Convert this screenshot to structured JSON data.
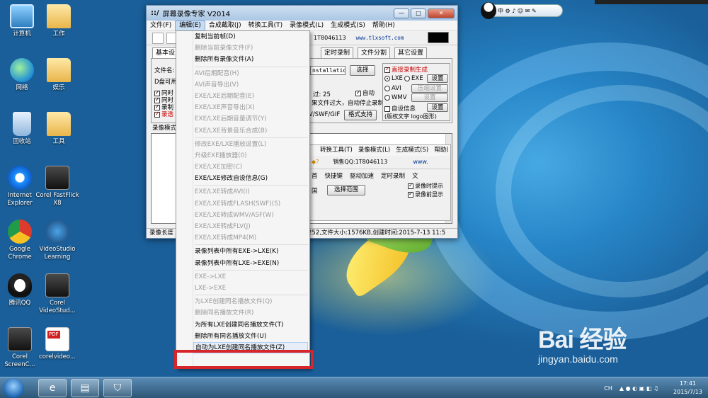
{
  "desktop_icons": [
    {
      "label": "计算机",
      "icon": "computer-icon"
    },
    {
      "label": "工作",
      "icon": "folder-icon"
    },
    {
      "label": "网络",
      "icon": "network-icon"
    },
    {
      "label": "娱乐",
      "icon": "folder-icon"
    },
    {
      "label": "回收站",
      "icon": "recycle-bin-icon"
    },
    {
      "label": "工具",
      "icon": "folder-icon"
    },
    {
      "label": "Internet Explorer",
      "icon": "ie-icon"
    },
    {
      "label": "Corel FastFlick X8",
      "icon": "corel-icon"
    },
    {
      "label": "Google Chrome",
      "icon": "chrome-icon"
    },
    {
      "label": "VideoStudio Learning",
      "icon": "videostudio-icon"
    },
    {
      "label": "腾讯QQ",
      "icon": "qq-icon"
    },
    {
      "label": "Corel VideoStud...",
      "icon": "corel-icon"
    },
    {
      "label": "Corel ScreenC...",
      "icon": "corel-icon"
    },
    {
      "label": "corelvideo...",
      "icon": "pdf-icon"
    }
  ],
  "window": {
    "title": "屏幕录像专家 V2014",
    "logo": "::/",
    "controls": {
      "minimize": "—",
      "maximize": "□",
      "close": "✕"
    },
    "menu": [
      "文件(F)",
      "编辑(E)",
      "合成截取(J)",
      "转换工具(T)",
      "录像模式(L)",
      "生成模式(S)",
      "帮助(H)"
    ],
    "toolbar_qq": "1T8046113",
    "toolbar_url": "www.tlxsoft.com",
    "tabs": [
      "基本设",
      "定时录制",
      "文件分割",
      "其它设置"
    ],
    "filename_label": "文件名:",
    "drive_label": "D盘可用",
    "checks_left": [
      "同时",
      "同时",
      "录制",
      "录透"
    ],
    "path_value": "nstallatio",
    "select_button": "选择",
    "frame_label": "过: 25",
    "auto_label": "自动",
    "overflow_label": "果文件过大，自动停止录制",
    "format_label": "V/SWF/GIF",
    "format_support_button": "格式支持",
    "direct_record": "直接录制生成",
    "radio_lxe": "LXE",
    "radio_exe": "EXE",
    "radio_avi": "AVI",
    "radio_wmv": "WMV",
    "btn_settings": "设置",
    "btn_compress_settings": "压缩设置",
    "auto_info": "自设信息",
    "copyright_note": "(版权文字 logo图形)",
    "record_mode_label": "录像模式",
    "status_left": "录像长度",
    "status_right": "252,文件大小:1576KB,创建时间:2015-7-13 11:5"
  },
  "nested_window": {
    "menu": [
      "转换工具(T)",
      "录像模式(L)",
      "生成模式(S)",
      "帮助("
    ],
    "qq": "销售QQ:1T8046113",
    "url": "www.",
    "tabs": [
      "首",
      "快捷键",
      "驱动加速",
      "定时录制",
      "文"
    ],
    "range_left": "国",
    "select_range_button": "选择范围",
    "check1": "录像时提示",
    "check2": "录像前显示"
  },
  "edit_menu": [
    {
      "label": "复制当前帧(D)",
      "enabled": true
    },
    {
      "label": "删除当前录像文件(F)",
      "enabled": false
    },
    {
      "label": "删除所有录像文件(A)",
      "enabled": true
    },
    {
      "sep": true
    },
    {
      "label": "AVI后期配音(H)",
      "enabled": false
    },
    {
      "label": "AVI声音导出(V)",
      "enabled": false
    },
    {
      "label": "EXE/LXE后期配音(E)",
      "enabled": false
    },
    {
      "label": "EXE/LXE声音导出(X)",
      "enabled": false
    },
    {
      "label": "EXE/LXE后期音量调节(Y)",
      "enabled": false
    },
    {
      "label": "EXE/LXE背景音乐合成(B)",
      "enabled": false
    },
    {
      "sep": true
    },
    {
      "label": "修改EXE/LXE播放设置(L)",
      "enabled": false
    },
    {
      "label": "升级EXE播放器(0)",
      "enabled": false
    },
    {
      "label": "EXE/LXE加密(C)",
      "enabled": false
    },
    {
      "label": "EXE/LXE修改自设信息(G)",
      "enabled": true
    },
    {
      "sep": true
    },
    {
      "label": "EXE/LXE转成AVI(I)",
      "enabled": false
    },
    {
      "label": "EXE/LXE转成FLASH(SWF)(S)",
      "enabled": false
    },
    {
      "label": "EXE/LXE转成WMV/ASF(W)",
      "enabled": false
    },
    {
      "label": "EXE/LXE转成FLV(J)",
      "enabled": false
    },
    {
      "label": "EXE/LXE转成MP4(M)",
      "enabled": false
    },
    {
      "sep": true
    },
    {
      "label": "录像列表中所有EXE->LXE(K)",
      "enabled": true
    },
    {
      "label": "录像列表中所有LXE->EXE(N)",
      "enabled": true
    },
    {
      "sep": true
    },
    {
      "label": "EXE->LXE",
      "enabled": false
    },
    {
      "label": "LXE->EXE",
      "enabled": false
    },
    {
      "sep": true
    },
    {
      "label": "为LXE创建同名播放文件(Q)",
      "enabled": false
    },
    {
      "label": "删除同名播放文件(R)",
      "enabled": false
    },
    {
      "label": "为所有LXE创建同名播放文件(T)",
      "enabled": true
    },
    {
      "label": "删除所有同名播放文件(U)",
      "enabled": true
    },
    {
      "label": "自动为LXE创建同名播放文件(Z)",
      "enabled": true,
      "highlighted": true
    }
  ],
  "taskbar": {
    "tray_lang": "CH",
    "time": "17:41",
    "date": "2015/7/13"
  },
  "qqbar": {
    "label": "中 ⚙ ♪ ☺ ✉ ✎"
  },
  "watermark": {
    "brand": "Bai 经验",
    "url": "jingyan.baidu.com"
  },
  "colors": {
    "highlight_border": "#d6262c",
    "menu_disabled": "#9a9a9a"
  }
}
